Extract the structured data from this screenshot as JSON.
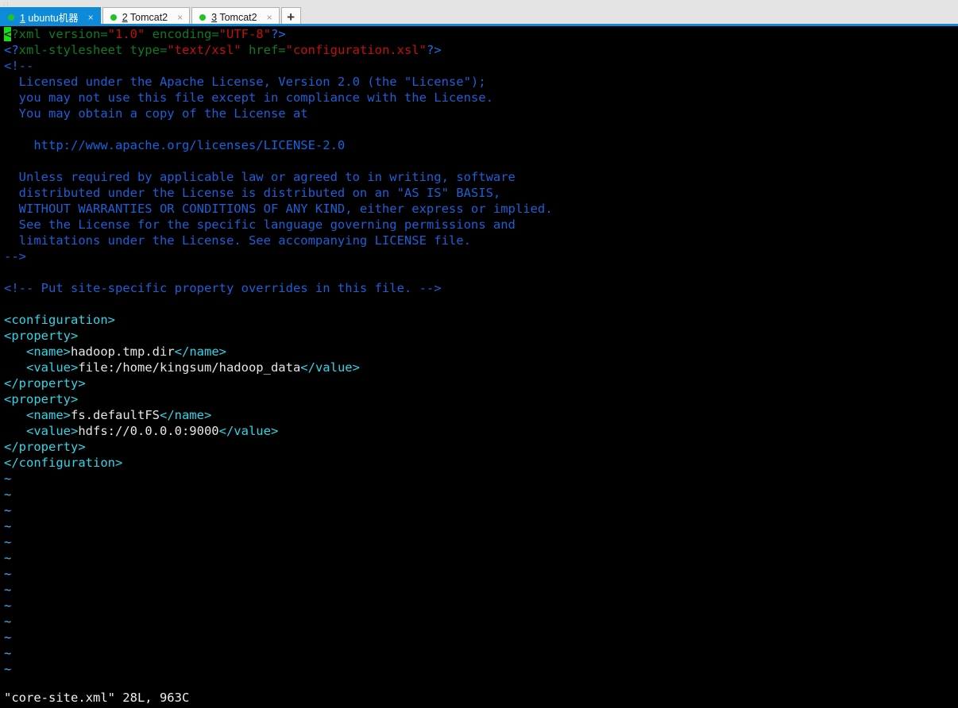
{
  "window": {
    "corner_mark": "::",
    "accent_color": "#0d8bd9",
    "tabbar_bg": "#e4e4e4"
  },
  "tabs": [
    {
      "index": "1",
      "accel": "1",
      "title": " ubuntu机器",
      "status_dot": "green-dot-icon",
      "close": "×",
      "active": true
    },
    {
      "index": "2",
      "accel": "2",
      "title": " Tomcat2",
      "status_dot": "green-dot-icon",
      "close": "×",
      "active": false
    },
    {
      "index": "3",
      "accel": "3",
      "title": " Tomcat2",
      "status_dot": "green-dot-icon",
      "close": "×",
      "active": false
    }
  ],
  "new_tab_button": {
    "label": "+",
    "name": "new-tab-button"
  },
  "editor": {
    "filename": "core-site.xml",
    "status_line": "\"core-site.xml\" 28L, 963C",
    "cursor_char": "<",
    "empty_marker": "~",
    "empty_line_count": 13,
    "lines": [
      {
        "n": 1,
        "segments": [
          {
            "text": "<",
            "cls": "cursor"
          },
          {
            "text": "?xml version=",
            "cls": "c-piname"
          },
          {
            "text": "\"1.0\"",
            "cls": "c-string"
          },
          {
            "text": " encoding=",
            "cls": "c-piname"
          },
          {
            "text": "\"UTF-8\"",
            "cls": "c-string"
          },
          {
            "text": "?>",
            "cls": "c-pidelim"
          }
        ]
      },
      {
        "n": 2,
        "segments": [
          {
            "text": "<?",
            "cls": "c-pidelim"
          },
          {
            "text": "xml-stylesheet type=",
            "cls": "c-piname"
          },
          {
            "text": "\"text/xsl\"",
            "cls": "c-string"
          },
          {
            "text": " href=",
            "cls": "c-attr"
          },
          {
            "text": "\"configuration.xsl\"",
            "cls": "c-string"
          },
          {
            "text": "?>",
            "cls": "c-pidelim"
          }
        ]
      },
      {
        "n": 3,
        "segments": [
          {
            "text": "<!--",
            "cls": "c-comment"
          }
        ]
      },
      {
        "n": 4,
        "segments": [
          {
            "text": "  Licensed under the Apache License, Version 2.0 (the \"License\");",
            "cls": "c-comment"
          }
        ]
      },
      {
        "n": 5,
        "segments": [
          {
            "text": "  you may not use this file except in compliance with the License.",
            "cls": "c-comment"
          }
        ]
      },
      {
        "n": 6,
        "segments": [
          {
            "text": "  You may obtain a copy of the License at",
            "cls": "c-comment"
          }
        ]
      },
      {
        "n": 7,
        "segments": [
          {
            "text": "",
            "cls": "c-comment"
          }
        ]
      },
      {
        "n": 8,
        "segments": [
          {
            "text": "    http://www.apache.org/licenses/LICENSE-2.0",
            "cls": "c-url"
          }
        ]
      },
      {
        "n": 9,
        "segments": [
          {
            "text": "",
            "cls": "c-comment"
          }
        ]
      },
      {
        "n": 10,
        "segments": [
          {
            "text": "  Unless required by applicable law or agreed to in writing, software",
            "cls": "c-comment"
          }
        ]
      },
      {
        "n": 11,
        "segments": [
          {
            "text": "  distributed under the License is distributed on an \"AS IS\" BASIS,",
            "cls": "c-comment"
          }
        ]
      },
      {
        "n": 12,
        "segments": [
          {
            "text": "  WITHOUT WARRANTIES OR CONDITIONS OF ANY KIND, either express or implied.",
            "cls": "c-comment"
          }
        ]
      },
      {
        "n": 13,
        "segments": [
          {
            "text": "  See the License for the specific language governing permissions and",
            "cls": "c-comment"
          }
        ]
      },
      {
        "n": 14,
        "segments": [
          {
            "text": "  limitations under the License. See accompanying LICENSE file.",
            "cls": "c-comment"
          }
        ]
      },
      {
        "n": 15,
        "segments": [
          {
            "text": "-->",
            "cls": "c-comment"
          }
        ]
      },
      {
        "n": 16,
        "segments": [
          {
            "text": "",
            "cls": "c-comment"
          }
        ]
      },
      {
        "n": 17,
        "segments": [
          {
            "text": "<!-- Put site-specific property overrides in this file. -->",
            "cls": "c-comment"
          }
        ]
      },
      {
        "n": 18,
        "segments": [
          {
            "text": "",
            "cls": "c-comment"
          }
        ]
      },
      {
        "n": 19,
        "segments": [
          {
            "text": "<configuration>",
            "cls": "c-tag"
          }
        ]
      },
      {
        "n": 20,
        "segments": [
          {
            "text": "<property>",
            "cls": "c-tag"
          }
        ]
      },
      {
        "n": 21,
        "segments": [
          {
            "text": "   <name>",
            "cls": "c-tag"
          },
          {
            "text": "hadoop.tmp.dir",
            "cls": "c-text"
          },
          {
            "text": "</name>",
            "cls": "c-tag"
          }
        ]
      },
      {
        "n": 22,
        "segments": [
          {
            "text": "   <value>",
            "cls": "c-tag"
          },
          {
            "text": "file:/home/kingsum/hadoop_data",
            "cls": "c-text"
          },
          {
            "text": "</value>",
            "cls": "c-tag"
          }
        ]
      },
      {
        "n": 23,
        "segments": [
          {
            "text": "</property>",
            "cls": "c-tag"
          }
        ]
      },
      {
        "n": 24,
        "segments": [
          {
            "text": "<property>",
            "cls": "c-tag"
          }
        ]
      },
      {
        "n": 25,
        "segments": [
          {
            "text": "   <name>",
            "cls": "c-tag"
          },
          {
            "text": "fs.defaultFS",
            "cls": "c-text"
          },
          {
            "text": "</name>",
            "cls": "c-tag"
          }
        ]
      },
      {
        "n": 26,
        "segments": [
          {
            "text": "   <value>",
            "cls": "c-tag"
          },
          {
            "text": "hdfs://0.0.0.0:9000",
            "cls": "c-text"
          },
          {
            "text": "</value>",
            "cls": "c-tag"
          }
        ]
      },
      {
        "n": 27,
        "segments": [
          {
            "text": "</property>",
            "cls": "c-tag"
          }
        ]
      },
      {
        "n": 28,
        "segments": [
          {
            "text": "</configuration>",
            "cls": "c-tag"
          }
        ]
      }
    ]
  }
}
